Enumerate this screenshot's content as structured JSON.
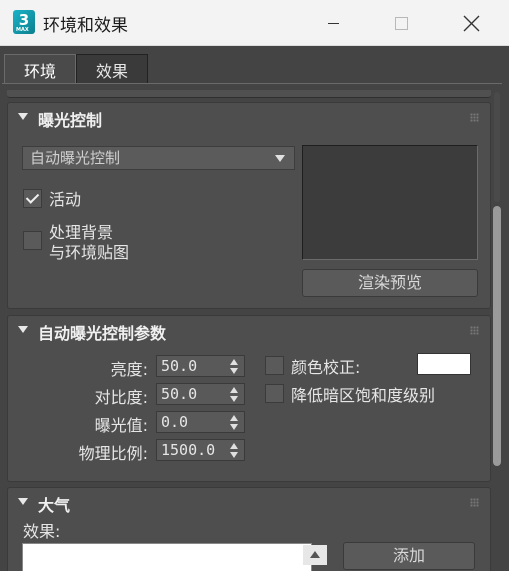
{
  "window": {
    "title": "环境和效果",
    "app_icon_label": "3",
    "app_icon_sub": "MAX",
    "icons": {
      "minimize": "minimize-icon",
      "maximize": "maximize-icon",
      "close": "close-icon"
    }
  },
  "tabs": [
    {
      "label": "环境",
      "active": true
    },
    {
      "label": "效果",
      "active": false
    }
  ],
  "exposure_control": {
    "title": "曝光控制",
    "dropdown_value": "自动曝光控制",
    "active_label": "活动",
    "active_checked": true,
    "process_bg_label_line1": "处理背景",
    "process_bg_label_line2": "与环境贴图",
    "process_bg_checked": false,
    "render_preview_label": "渲染预览"
  },
  "auto_exposure_params": {
    "title": "自动曝光控制参数",
    "params": [
      {
        "label": "亮度:",
        "value": "50.0"
      },
      {
        "label": "对比度:",
        "value": "50.0"
      },
      {
        "label": "曝光值:",
        "value": "0.0"
      },
      {
        "label": "物理比例:",
        "value": "1500.0"
      }
    ],
    "color_correction_label": "颜色校正:",
    "color_correction_checked": false,
    "color_correction_color": "#ffffff",
    "desaturate_label": "降低暗区饱和度级别",
    "desaturate_checked": false
  },
  "atmosphere": {
    "title": "大气",
    "effects_label": "效果:",
    "add_label": "添加"
  },
  "colors": {
    "panel_bg": "#444444",
    "rollout_bg": "#4e4e4e",
    "title_bar_bg": "#f3f3f3"
  }
}
